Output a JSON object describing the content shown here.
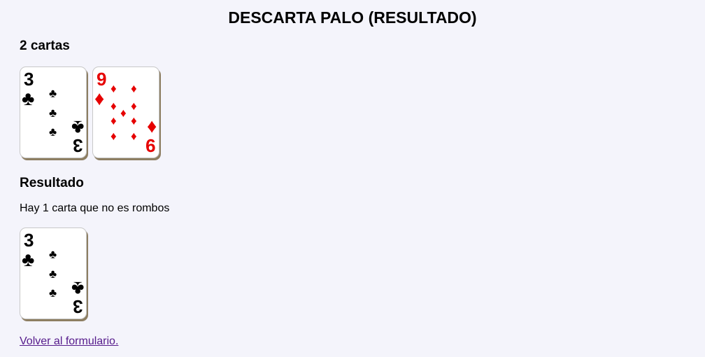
{
  "page": {
    "title": "DESCARTA PALO (RESULTADO)"
  },
  "hand": {
    "heading": "2 cartas",
    "cards": [
      {
        "rank": "3",
        "suit": "♣",
        "suit_name": "tréboles",
        "color": "#000000",
        "pip_count": 3
      },
      {
        "rank": "9",
        "suit": "♦",
        "suit_name": "rombos",
        "color": "#e60000",
        "pip_count": 9
      }
    ]
  },
  "result": {
    "heading": "Resultado",
    "text": "Hay 1 carta que no es rombos",
    "cards": [
      {
        "rank": "3",
        "suit": "♣",
        "suit_name": "tréboles",
        "color": "#000000",
        "pip_count": 3
      }
    ]
  },
  "footer": {
    "back_link": "Volver al formulario."
  }
}
